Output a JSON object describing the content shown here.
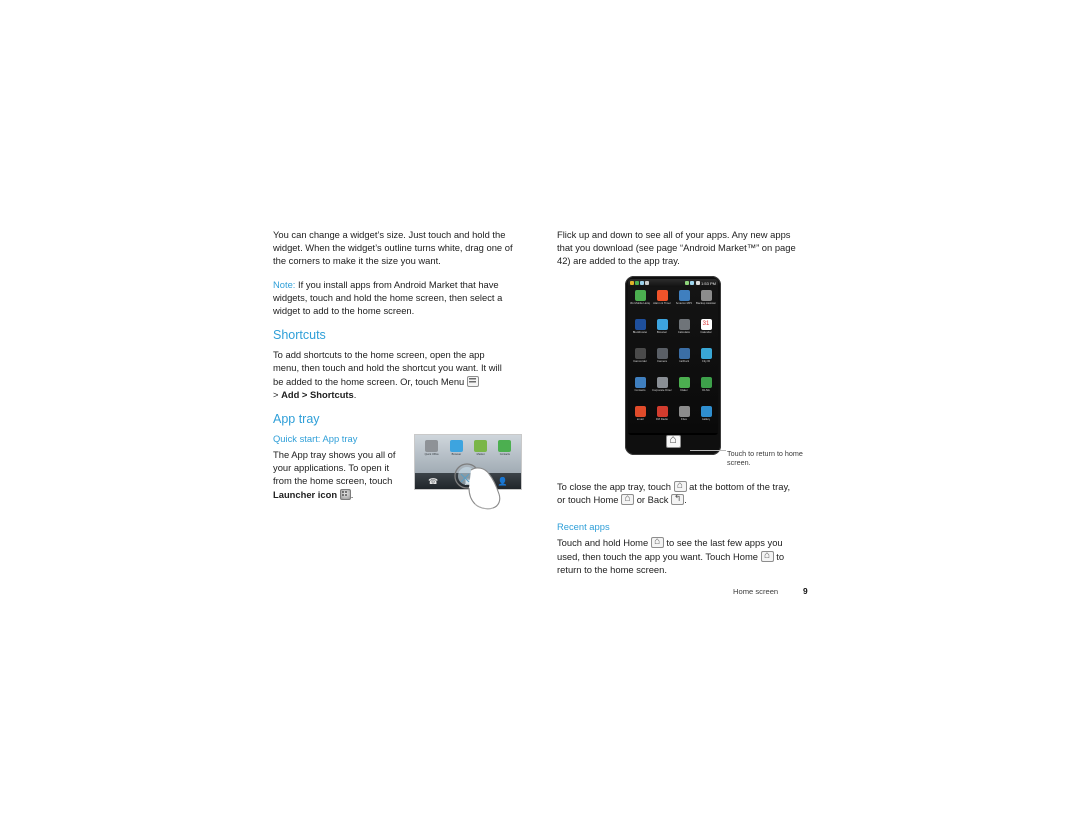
{
  "document": {
    "footer": {
      "section": "Home screen",
      "page_number": "9"
    }
  },
  "left_column": {
    "para_widget_resize": "You can change a widget’s size. Just touch and hold the widget. When the widget’s outline turns white, drag one of the corners to make it the size you want.",
    "note_label": "Note:",
    "note_text": " If you install apps from Android Market that have widgets, touch and hold the home screen, then select a widget to add to the home screen.",
    "heading_shortcuts": "Shortcuts",
    "para_shortcuts_1": "To add shortcuts to the home screen, open the app menu, then touch and hold the shortcut you want. It will be added to the home screen. Or, touch Menu ",
    "para_shortcuts_2": "> ",
    "para_shortcuts_bold": "Add > Shortcuts",
    "para_shortcuts_3": ".",
    "heading_app_tray": "App tray",
    "quick_start": "Quick start: App tray",
    "para_app_tray_1": "The App tray shows you all of your applications. To open it from the home screen, touch ",
    "para_app_tray_bold": "Launcher icon",
    "para_app_tray_2": "."
  },
  "right_column": {
    "para_flick": "Flick up and down to see all of your apps. Any new apps that you download (see page “Android Market™” on page 42) are added to the app tray.",
    "callout": "Touch to return to home screen.",
    "para_close_1": "To close the app tray, touch ",
    "para_close_2": " at the bottom of the tray, or touch Home ",
    "para_close_3": " or Back ",
    "para_close_4": ".",
    "heading_recent": "Recent apps",
    "para_recent_1": "Touch and hold Home ",
    "para_recent_2": " to see the last few apps you used, then touch the app you want. Touch Home ",
    "para_recent_3": " to return to the home screen."
  },
  "phone_illustration": {
    "status_bar": {
      "time": "1:53 PM"
    },
    "apps": [
      {
        "label": "3G Mobile Hotspot",
        "color": "#4caf50"
      },
      {
        "label": "Alarm & Timer",
        "color": "#f0532a"
      },
      {
        "label": "Amazon MP3",
        "color": "#3f7fbf"
      },
      {
        "label": "Backup Assistant",
        "color": "#8c8c8c"
      },
      {
        "label": "Blockbuster",
        "color": "#1e4f9c"
      },
      {
        "label": "Browser",
        "color": "#3da4df"
      },
      {
        "label": "Calculator",
        "color": "#6f7479"
      },
      {
        "label": "Calendar",
        "color": "#ffffff"
      },
      {
        "label": "Camcorder",
        "color": "#4a4a4a"
      },
      {
        "label": "Camera",
        "color": "#5a5f66"
      },
      {
        "label": "CarDock",
        "color": "#3b6ea5"
      },
      {
        "label": "City ID",
        "color": "#39a7d6"
      },
      {
        "label": "Contacts",
        "color": "#3f7fbf"
      },
      {
        "label": "Corporate Directory",
        "color": "#8a8f95"
      },
      {
        "label": "Dialer",
        "color": "#4caf50"
      },
      {
        "label": "DLNA",
        "color": "#3da04a"
      },
      {
        "label": "Email",
        "color": "#e04b2a"
      },
      {
        "label": "FM Radio",
        "color": "#d23c2e"
      },
      {
        "label": "Files",
        "color": "#8c8c8c"
      },
      {
        "label": "Gallery",
        "color": "#2f8fd0"
      }
    ],
    "home_button_icon": "home-icon"
  },
  "home_thumbnail": {
    "apps": [
      {
        "label": "Quick Office",
        "color": "#8e9297"
      },
      {
        "label": "Browser",
        "color": "#3da4df"
      },
      {
        "label": "Market",
        "color": "#7ab648"
      },
      {
        "label": "Contacts",
        "color": "#4caf50"
      }
    ],
    "dock_icons": [
      "phone-icon",
      "launcher-icon",
      "contacts-icon"
    ]
  },
  "colors": {
    "heading_blue": "#2f9fd8",
    "body_text": "#212121"
  }
}
